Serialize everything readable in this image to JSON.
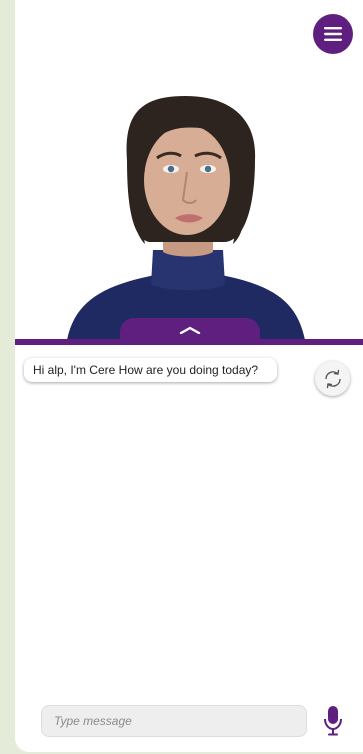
{
  "chat": {
    "message": "Hi alp, I'm Cere How are you doing today?"
  },
  "composer": {
    "placeholder": "Type message"
  },
  "colors": {
    "brand_purple": "#5f1f7f",
    "page_background": "#e4ecd9"
  },
  "icons": {
    "menu": "hamburger-menu-icon",
    "toggle": "chevron-up-icon",
    "refresh": "refresh-icon",
    "mic": "microphone-icon"
  }
}
